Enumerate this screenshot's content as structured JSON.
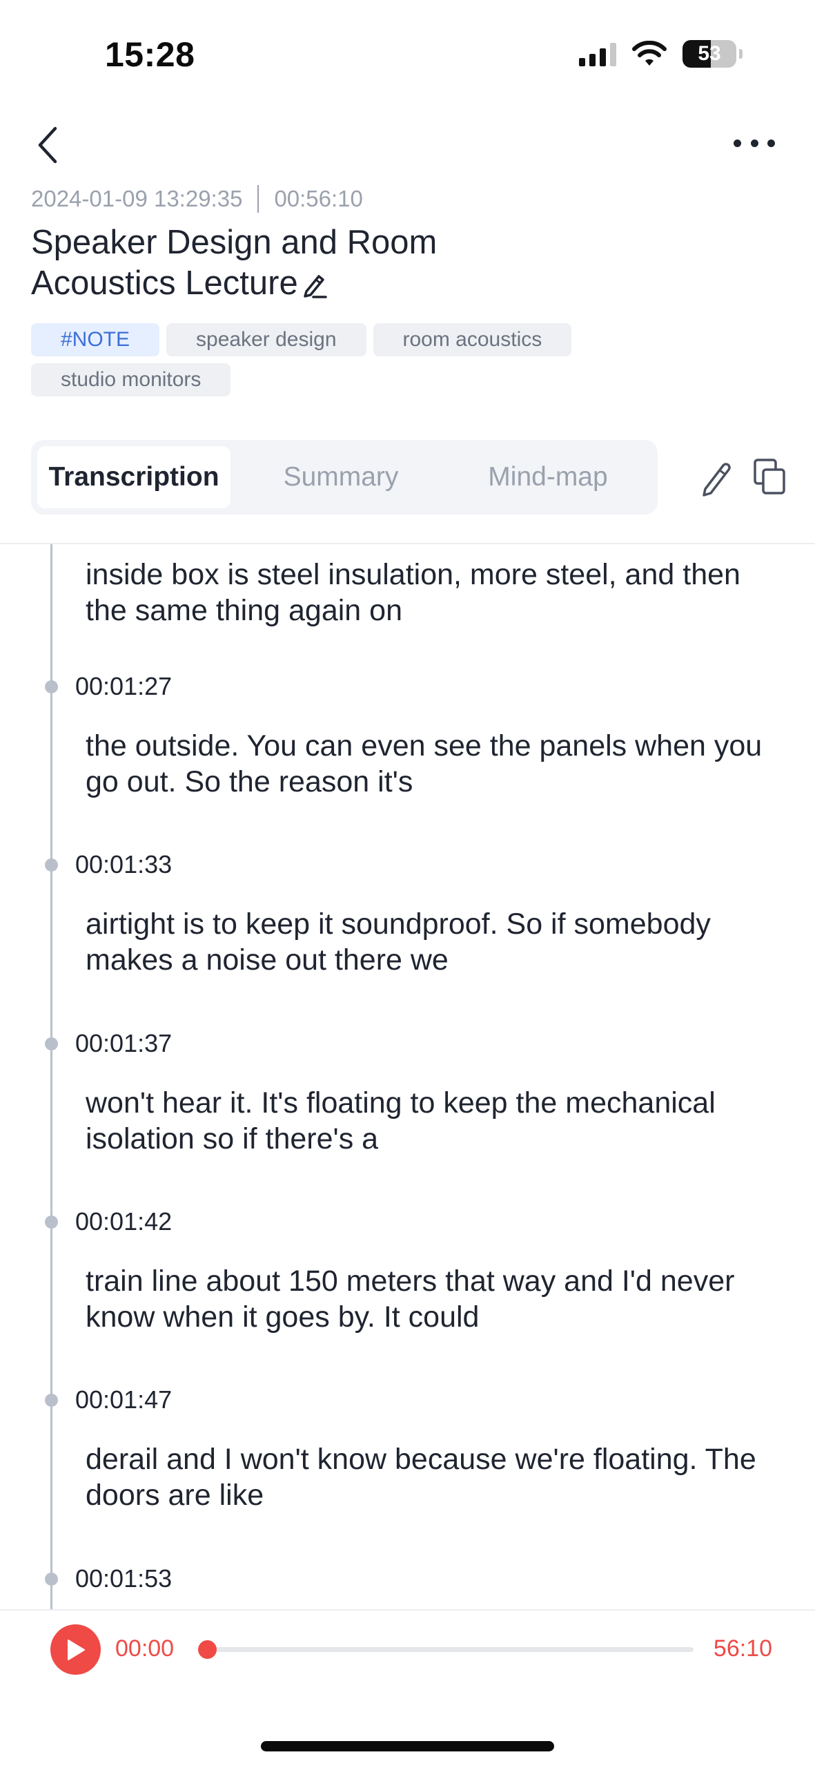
{
  "status_bar": {
    "time": "15:28",
    "battery": "53",
    "battery_level": 0.53
  },
  "header": {
    "back_icon": "chevron-left-icon",
    "more_icon": "more-horizontal-icon",
    "date": "2024-01-09 13:29:35",
    "duration": "00:56:10",
    "title": "Speaker Design and Room Acoustics Lecture",
    "title_edit_icon": "pencil-icon"
  },
  "tags": [
    "#NOTE",
    "speaker design",
    "room acoustics",
    "studio monitors"
  ],
  "tabs": {
    "items": [
      "Transcription",
      "Summary",
      "Mind-map"
    ],
    "active": "Transcription",
    "edit_icon": "pencil-icon",
    "copy_icon": "copy-icon"
  },
  "transcript": {
    "segments": [
      {
        "time": "",
        "text": "inside box is steel insulation, more steel, and then the same thing again on"
      },
      {
        "time": "00:01:27",
        "text": "the outside. You can even see the panels when you go out. So the reason it's"
      },
      {
        "time": "00:01:33",
        "text": "airtight is to keep it soundproof. So if somebody makes a noise out there we"
      },
      {
        "time": "00:01:37",
        "text": "won't hear it. It's floating to keep the mechanical isolation so if there's a"
      },
      {
        "time": "00:01:42",
        "text": "train line about 150 meters that way and I'd never know when it goes by. It could"
      },
      {
        "time": "00:01:47",
        "text": "derail and I won't know because we're floating. The doors are like"
      },
      {
        "time": "00:01:53",
        "text": ""
      }
    ]
  },
  "player": {
    "play_icon": "play-icon",
    "current": "00:00",
    "total": "56:10",
    "progress": 0.0
  },
  "colors": {
    "accent": "#ef4a46",
    "tag_note_bg": "#e6efff",
    "tag_note_text": "#3c6fd6",
    "text_primary": "#1f2430",
    "text_muted": "#9aa1ad"
  }
}
